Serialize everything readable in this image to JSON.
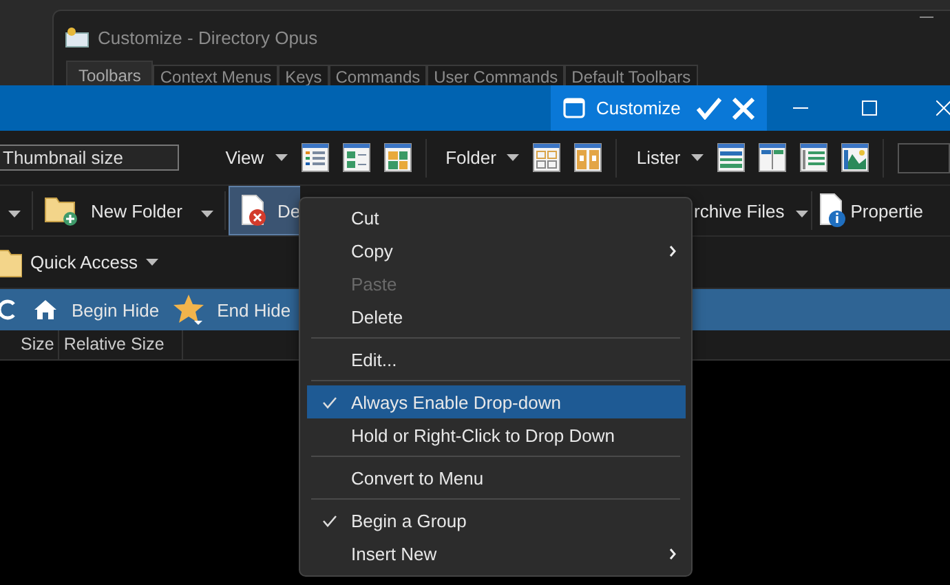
{
  "back_window": {
    "title": "Customize - Directory Opus",
    "tabs": [
      {
        "label": "Toolbars",
        "selected": true
      },
      {
        "label": "Context Menus",
        "selected": false
      },
      {
        "label": "Keys",
        "selected": false
      },
      {
        "label": "Commands",
        "selected": false
      },
      {
        "label": "User Commands",
        "selected": false
      },
      {
        "label": "Default Toolbars",
        "selected": false
      }
    ]
  },
  "title_bar": {
    "customize_label": "Customize"
  },
  "toolbar_1": {
    "thumbnail_field": "Thumbnail size",
    "view": "View",
    "folder": "Folder",
    "lister": "Lister"
  },
  "toolbar_2": {
    "new_folder": "New Folder",
    "delete": {
      "label": "De",
      "selected": true
    },
    "archive": "rchive Files",
    "properties": "Propertie"
  },
  "toolbar_3": {
    "quick_access": "Quick Access"
  },
  "hide_bar": {
    "begin_hide": "Begin Hide",
    "end_hide": "End Hide"
  },
  "columns": [
    "Size",
    "Relative Size"
  ],
  "context_menu": {
    "items": [
      {
        "kind": "item",
        "label": "Cut",
        "checked": false,
        "disabled": false,
        "selected": false,
        "submenu": false
      },
      {
        "kind": "item",
        "label": "Copy",
        "checked": false,
        "disabled": false,
        "selected": false,
        "submenu": true
      },
      {
        "kind": "item",
        "label": "Paste",
        "checked": false,
        "disabled": true,
        "selected": false,
        "submenu": false
      },
      {
        "kind": "item",
        "label": "Delete",
        "checked": false,
        "disabled": false,
        "selected": false,
        "submenu": false
      },
      {
        "kind": "separator"
      },
      {
        "kind": "item",
        "label": "Edit...",
        "checked": false,
        "disabled": false,
        "selected": false,
        "submenu": false
      },
      {
        "kind": "separator"
      },
      {
        "kind": "item",
        "label": "Always Enable Drop-down",
        "checked": true,
        "disabled": false,
        "selected": true,
        "submenu": false
      },
      {
        "kind": "item",
        "label": "Hold or Right-Click to Drop Down",
        "checked": false,
        "disabled": false,
        "selected": false,
        "submenu": false
      },
      {
        "kind": "separator"
      },
      {
        "kind": "item",
        "label": "Convert to Menu",
        "checked": false,
        "disabled": false,
        "selected": false,
        "submenu": false
      },
      {
        "kind": "separator"
      },
      {
        "kind": "item",
        "label": "Begin a Group",
        "checked": true,
        "disabled": false,
        "selected": false,
        "submenu": false
      },
      {
        "kind": "item",
        "label": "Insert New",
        "checked": false,
        "disabled": false,
        "selected": false,
        "submenu": true
      }
    ]
  }
}
